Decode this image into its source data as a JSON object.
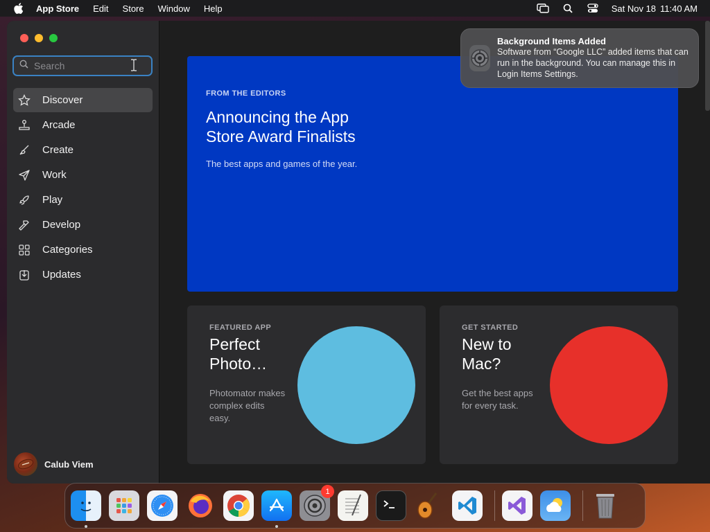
{
  "menubar": {
    "app_name": "App Store",
    "items": [
      "Edit",
      "Store",
      "Window",
      "Help"
    ],
    "date": "Sat Nov 18",
    "time": "11:40 AM"
  },
  "sidebar": {
    "search_placeholder": "Search",
    "items": [
      {
        "label": "Discover",
        "icon": "star-icon",
        "active": true
      },
      {
        "label": "Arcade",
        "icon": "joystick-icon"
      },
      {
        "label": "Create",
        "icon": "paintbrush-icon"
      },
      {
        "label": "Work",
        "icon": "paperplane-icon"
      },
      {
        "label": "Play",
        "icon": "rocket-icon"
      },
      {
        "label": "Develop",
        "icon": "hammer-icon"
      },
      {
        "label": "Categories",
        "icon": "grid-icon"
      },
      {
        "label": "Updates",
        "icon": "download-icon"
      }
    ],
    "profile_name": "Calub Viem"
  },
  "hero": {
    "eyebrow": "FROM THE EDITORS",
    "title": "Announcing the App Store Award Finalists",
    "subtitle": "The best apps and games of the year.",
    "color": "#0038c2"
  },
  "cards": [
    {
      "eyebrow": "FEATURED APP",
      "title": "Perfect Photo…",
      "subtitle": "Photomator makes complex edits easy.",
      "circle_color": "#5ebde0"
    },
    {
      "eyebrow": "GET STARTED",
      "title": "New to Mac?",
      "subtitle": "Get the best apps for every task.",
      "circle_color": "#e7302a"
    }
  ],
  "notification": {
    "title": "Background Items Added",
    "body": "Software from “Google LLC” added items that can run in the background. You can manage this in Login Items Settings."
  },
  "dock": {
    "apps": [
      "finder",
      "launchpad",
      "safari",
      "firefox",
      "chrome",
      "app-store",
      "system-settings",
      "textedit",
      "terminal",
      "garageband",
      "vscode",
      "visual-studio",
      "weather",
      "trash"
    ],
    "badge_count": "1"
  },
  "colors": {
    "accent": "#3a82c4",
    "sidebar_bg": "#2b2b2d",
    "window_bg": "#1e1e1e"
  }
}
